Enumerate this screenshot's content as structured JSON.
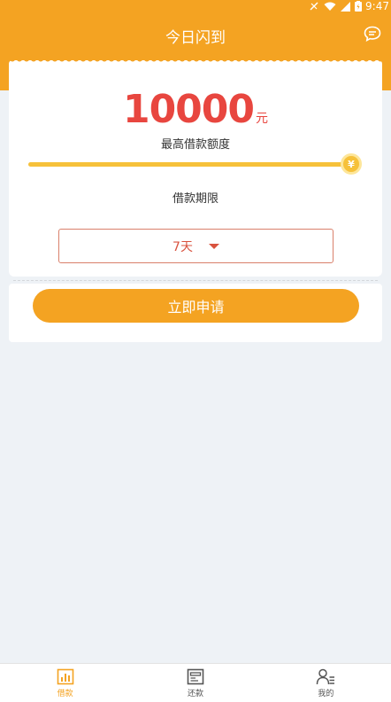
{
  "status_bar": {
    "time": "9:47"
  },
  "header": {
    "title": "今日闪到"
  },
  "loan": {
    "amount": "10000",
    "unit": "元",
    "amount_label": "最高借款额度",
    "slider_level_percent": 100,
    "currency_symbol": "¥",
    "term_label": "借款期限",
    "term_value": "7天"
  },
  "apply_button": "立即申请",
  "tabs": [
    {
      "label": "借款",
      "icon": "chart-icon",
      "active": true
    },
    {
      "label": "还款",
      "icon": "card-icon",
      "active": false
    },
    {
      "label": "我的",
      "icon": "user-icon",
      "active": false
    }
  ],
  "colors": {
    "accent": "#f4a322",
    "amount": "#e8463f",
    "slider": "#f6c13a"
  }
}
